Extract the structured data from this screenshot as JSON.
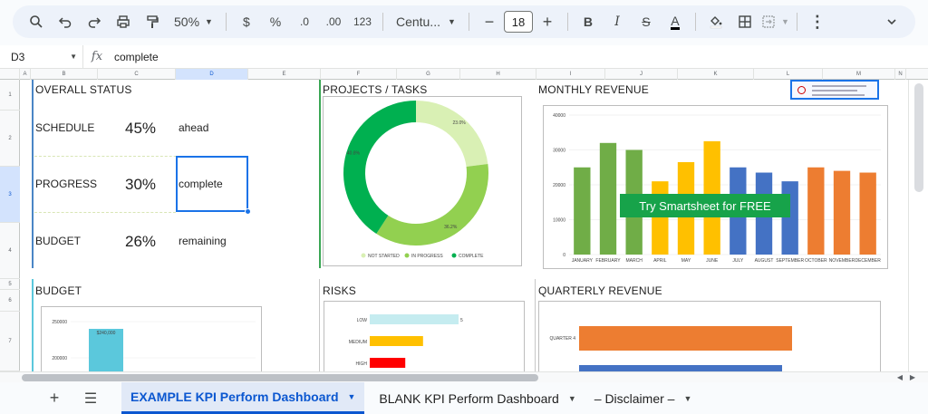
{
  "toolbar": {
    "zoom": "50%",
    "font_name": "Centu...",
    "font_size": "18",
    "currency": "$",
    "percent": "%",
    "dec_decrease": ".0",
    "dec_increase": ".00",
    "number_format": "123"
  },
  "formula_bar": {
    "cell_ref": "D3",
    "fx": "fx",
    "value": "complete"
  },
  "columns": [
    "A",
    "B",
    "C",
    "D",
    "E",
    "F",
    "G",
    "H",
    "I",
    "J",
    "K",
    "L",
    "M",
    "N"
  ],
  "rows": [
    "1",
    "2",
    "3",
    "4",
    "5",
    "6",
    "7"
  ],
  "status": {
    "title": "OVERALL STATUS",
    "schedule_label": "SCHEDULE",
    "schedule_value": "45%",
    "schedule_note": "ahead",
    "progress_label": "PROGRESS",
    "progress_value": "30%",
    "progress_note": "complete",
    "budget_label": "BUDGET",
    "budget_value": "26%",
    "budget_note": "remaining"
  },
  "panels": {
    "projects_title": "PROJECTS / TASKS",
    "monthly_title": "MONTHLY REVENUE",
    "budget_title": "BUDGET",
    "risks_title": "RISKS",
    "quarterly_title": "QUARTERLY REVENUE",
    "promo": "Try Smartsheet for FREE"
  },
  "chart_data": [
    {
      "type": "pie",
      "title": "",
      "categories": [
        "NOT STARTED",
        "IN PROGRESS",
        "COMPLETE"
      ],
      "values": [
        23.0,
        36.2,
        40.8
      ],
      "labels": [
        "23.0%",
        "36.2%",
        "40.8%"
      ],
      "colors": [
        "#d9f0b4",
        "#92d050",
        "#00b050"
      ],
      "legend": "bottom"
    },
    {
      "type": "bar",
      "title": "",
      "categories": [
        "JANUARY",
        "FEBRUARY",
        "MARCH",
        "APRIL",
        "MAY",
        "JUNE",
        "JULY",
        "AUGUST",
        "SEPTEMBER",
        "OCTOBER",
        "NOVEMBER",
        "DECEMBER"
      ],
      "values": [
        25000,
        32000,
        30000,
        21000,
        26500,
        32500,
        25000,
        23500,
        21000,
        25000,
        24000,
        23500
      ],
      "colors": [
        "#70ad47",
        "#70ad47",
        "#70ad47",
        "#ffc000",
        "#ffc000",
        "#ffc000",
        "#4472c4",
        "#4472c4",
        "#4472c4",
        "#ed7d31",
        "#ed7d31",
        "#ed7d31"
      ],
      "yticks": [
        "0",
        "10000",
        "20000",
        "30000",
        "40000"
      ],
      "ylim": [
        0,
        40000
      ]
    },
    {
      "type": "bar",
      "title": "",
      "categories": [
        "LOW",
        "MEDIUM",
        "HIGH"
      ],
      "values": [
        5,
        3,
        2
      ],
      "colors": [
        "#c5ecf0",
        "#ffc000",
        "#ff0000"
      ],
      "orientation": "horizontal"
    },
    {
      "type": "bar",
      "title": "",
      "yticks": [
        "250000",
        "200000"
      ],
      "value_label": "$240,000",
      "values": [
        240000,
        190000
      ],
      "colors": [
        "#5bc8dc",
        "#7ed3a0"
      ]
    },
    {
      "type": "bar",
      "orientation": "horizontal",
      "categories": [
        "QUARTER 4"
      ],
      "colors": [
        "#ed7d31",
        "#4472c4"
      ]
    }
  ],
  "tabs": [
    {
      "label": "EXAMPLE KPI Perform Dashboard",
      "active": true
    },
    {
      "label": "BLANK KPI Perform Dashboard",
      "active": false
    },
    {
      "label": "– Disclaimer –",
      "active": false
    }
  ]
}
